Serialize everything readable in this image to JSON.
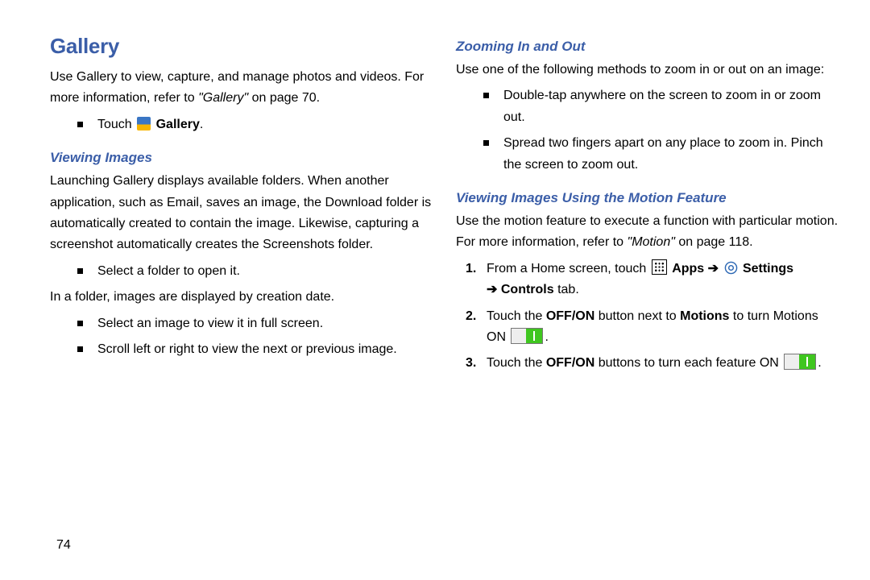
{
  "left": {
    "title": "Gallery",
    "p1": "Use Gallery to view, capture, and manage photos and videos. For more information, refer to ",
    "p1_ref": "\"Gallery\"",
    "p1_after": " on page 70.",
    "bul_touch_pre": "Touch ",
    "bul_touch_label": "Gallery",
    "bul_touch_post": ".",
    "sub1": "Viewing Images",
    "p2": "Launching Gallery displays available folders. When another application, such as Email, saves an image, the Download folder is automatically created to contain the image. Likewise, capturing a screenshot automatically creates the Screenshots folder.",
    "bul2": "Select a folder to open it.",
    "p3": "In a folder, images are displayed by creation date.",
    "bul3": "Select an image to view it in full screen.",
    "bul4": "Scroll left or right to view the next or previous image."
  },
  "right": {
    "sub1": "Zooming In and Out",
    "p1": "Use one of the following methods to zoom in or out on an image:",
    "bul1": "Double-tap anywhere on the screen to zoom in or zoom out.",
    "bul2": "Spread two fingers apart on any place to zoom in. Pinch the screen to zoom out.",
    "sub2": "Viewing Images Using the Motion Feature",
    "p2_pre": "Use the motion feature to execute a function with particular motion. For more information, refer to ",
    "p2_ref": "\"Motion\"",
    "p2_after": " on page 118.",
    "n1_num": "1.",
    "n1_pre": "From a Home screen, touch ",
    "n1_apps": "Apps",
    "n1_arrow": " ➔ ",
    "n1_settings": "Settings",
    "n1_arrow2": " ➔ ",
    "n1_controls": "Controls",
    "n1_post": " tab.",
    "n2_num": "2.",
    "n2_pre": "Touch the ",
    "n2_offon": "OFF/ON",
    "n2_mid": " button next to ",
    "n2_motions": "Motions",
    "n2_post": " to turn Motions ON ",
    "n2_end": ".",
    "n3_num": "3.",
    "n3_pre": "Touch the ",
    "n3_offon": "OFF/ON",
    "n3_post": " buttons to turn each feature ON ",
    "n3_end": "."
  },
  "page_no": "74"
}
